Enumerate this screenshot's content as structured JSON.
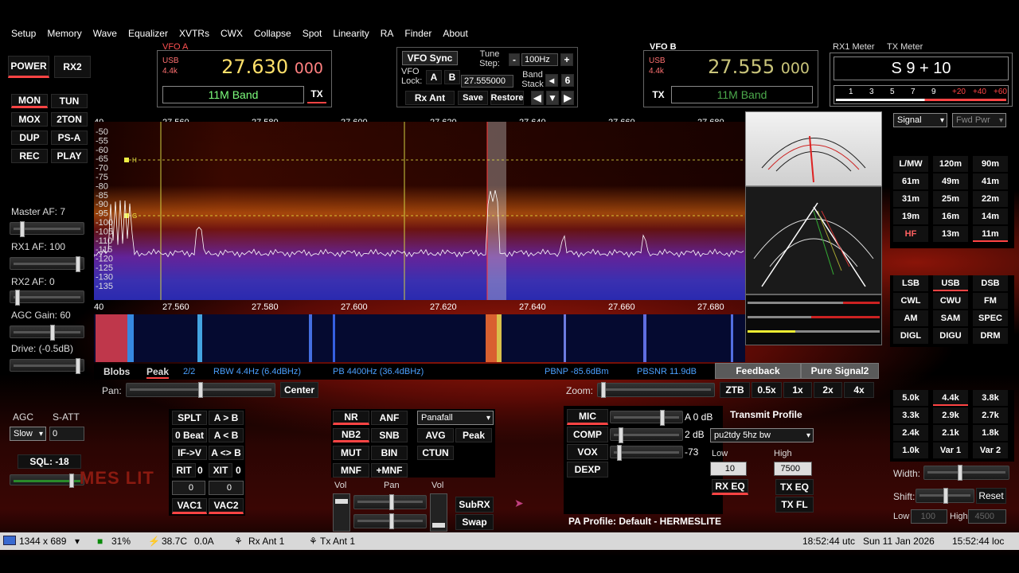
{
  "menu": [
    "Setup",
    "Memory",
    "Wave",
    "Equalizer",
    "XVTRs",
    "CWX",
    "Collapse",
    "Spot",
    "Linearity",
    "RA",
    "Finder",
    "About"
  ],
  "left": {
    "power": "POWER",
    "rx2": "RX2",
    "grid": [
      [
        "MON",
        "TUN"
      ],
      [
        "MOX",
        "2TON"
      ],
      [
        "DUP",
        "PS-A"
      ],
      [
        "REC",
        "PLAY"
      ]
    ],
    "master_af": "Master AF:  7",
    "rx1_af": "RX1 AF:  100",
    "rx2_af": "RX2 AF:  0",
    "agc_gain": "AGC Gain:  60",
    "drive": "Drive:  (-0.5dB)",
    "agc": "AGC",
    "satt": "S-ATT",
    "agc_mode": "Slow",
    "satt_val": "0",
    "sql": "SQL:  -18",
    "logo": "MES LIT"
  },
  "vfo_a": {
    "title": "VFO A",
    "mode": "USB",
    "bw": "4.4k",
    "freq_main": "27.630",
    "freq_sub": "000",
    "band": "11M Band",
    "tx": "TX"
  },
  "vfo_b": {
    "title": "VFO B",
    "mode": "USB",
    "bw": "4.4k",
    "freq_main": "27.555",
    "freq_sub": "000",
    "band": "11M Band",
    "tx": "TX"
  },
  "center": {
    "vfo_sync": "VFO Sync",
    "tune_step": "Tune Step:",
    "minus": "-",
    "step": "100Hz",
    "plus": "+",
    "vfo_lock": "VFO Lock:",
    "a": "A",
    "b": "B",
    "lock_freq": "27.555000",
    "band_stack": "Band Stack",
    "bs_left": "◂",
    "bs_num": "6",
    "rx_ant": "Rx Ant",
    "save": "Save",
    "restore": "Restore",
    "arr_l": "◀",
    "arr_d": "▼",
    "arr_r": "▶"
  },
  "meter": {
    "rx1": "RX1 Meter",
    "tx": "TX Meter",
    "reading": "S 9 + 10",
    "scale": [
      "1",
      "3",
      "5",
      "7",
      "9",
      "+20",
      "+40",
      "+60"
    ],
    "sel1": "Signal",
    "sel2": "Fwd Pwr"
  },
  "spectrum": {
    "freqs": [
      "40",
      "27.560",
      "27.580",
      "27.600",
      "27.620",
      "27.640",
      "27.660",
      "27.680"
    ],
    "db": [
      "-50",
      "-55",
      "-60",
      "-65",
      "-70",
      "-75",
      "-80",
      "-85",
      "-90",
      "-95",
      "-100",
      "-105",
      "-110",
      "-115",
      "-120",
      "-125",
      "-130",
      "-135"
    ],
    "marker_h": "H",
    "marker_g": "G"
  },
  "status": {
    "blobs": "Blobs",
    "peak": "Peak",
    "pages": "2/2",
    "rbw": "RBW 4.4Hz (6.4dBHz)",
    "pb": "PB 4400Hz (36.4dBHz)",
    "pbnp": "PBNP -85.6dBm",
    "pbsnr": "PBSNR 11.9dB",
    "feedback": "Feedback",
    "pure_signal": "Pure Signal2"
  },
  "pan": {
    "label": "Pan:",
    "center": "Center",
    "zoom": "Zoom:",
    "zoom_btns": [
      "ZTB",
      "0.5x",
      "1x",
      "2x",
      "4x"
    ]
  },
  "dsp": {
    "splt": "SPLT",
    "a_to_b": "A > B",
    "zero_beat": "0 Beat",
    "a_from_b": "A < B",
    "if_v": "IF->V",
    "swap_ab": "A <> B",
    "rit": "RIT",
    "rit_v": "0",
    "xit": "XIT",
    "xit_v": "0",
    "rit_field": "0",
    "xit_field": "0",
    "vac1": "VAC1",
    "vac2": "VAC2",
    "nr": "NR",
    "anf": "ANF",
    "nb2": "NB2",
    "snb": "SNB",
    "mut": "MUT",
    "bin": "BIN",
    "mnf": "MNF",
    "pmnf": "+MNF",
    "display_mode": "Panafall",
    "avg": "AVG",
    "peak": "Peak",
    "ctun": "CTUN",
    "vol": "Vol",
    "pan": "Pan",
    "vol2": "Vol",
    "subrx": "SubRX",
    "swap": "Swap"
  },
  "tx": {
    "mic": "MIC",
    "mic_val": "A 0 dB",
    "comp": "COMP",
    "comp_val": "2 dB",
    "vox": "VOX",
    "vox_val": "-73",
    "dexp": "DEXP",
    "profile_label": "Transmit Profile",
    "profile": "pu2tdy 5hz bw",
    "low": "Low",
    "high": "High",
    "low_val": "10",
    "high_val": "7500",
    "rx_eq": "RX EQ",
    "tx_eq": "TX EQ",
    "tx_fl": "TX FL",
    "pa_profile": "PA Profile: Default - HERMESLITE"
  },
  "bands": [
    [
      "L/MW",
      "120m",
      "90m"
    ],
    [
      "61m",
      "49m",
      "41m"
    ],
    [
      "31m",
      "25m",
      "22m"
    ],
    [
      "19m",
      "16m",
      "14m"
    ],
    [
      "HF",
      "13m",
      "11m"
    ]
  ],
  "modes": [
    [
      "LSB",
      "USB",
      "DSB"
    ],
    [
      "CWL",
      "CWU",
      "FM"
    ],
    [
      "AM",
      "SAM",
      "SPEC"
    ],
    [
      "DIGL",
      "DIGU",
      "DRM"
    ]
  ],
  "filters": [
    [
      "5.0k",
      "4.4k",
      "3.8k"
    ],
    [
      "3.3k",
      "2.9k",
      "2.7k"
    ],
    [
      "2.4k",
      "2.1k",
      "1.8k"
    ],
    [
      "1.0k",
      "Var 1",
      "Var 2"
    ]
  ],
  "filter_ctrl": {
    "width": "Width:",
    "shift": "Shift:",
    "reset": "Reset",
    "low": "Low",
    "low_val": "100",
    "high": "High",
    "high_val": "4500"
  },
  "taskbar": {
    "res": "1344 x 689",
    "cpu": "31%",
    "temp": "38.7C",
    "amps": "0.0A",
    "rx_ant": "Rx Ant 1",
    "tx_ant": "Tx Ant 1",
    "utc": "18:52:44 utc",
    "date": "Sun 11 Jan 2026",
    "local": "15:52:44 loc"
  },
  "colors": {
    "accent": "#ff4444",
    "vfo_freq": "#ffe06a",
    "band_text": "#7dff7d",
    "stat_text": "#4aa0ff"
  }
}
